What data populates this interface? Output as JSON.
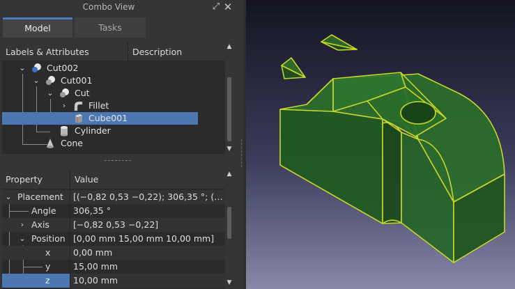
{
  "combo_view": {
    "title": "Combo View",
    "tabs": [
      {
        "label": "Model",
        "active": true
      },
      {
        "label": "Tasks",
        "active": false
      }
    ]
  },
  "tree": {
    "columns": [
      "Labels & Attributes",
      "Description"
    ],
    "items": [
      {
        "label": "Cut002",
        "icon": "cut-icon",
        "expanded": true,
        "depth": 1
      },
      {
        "label": "Cut001",
        "icon": "cut-icon",
        "expanded": true,
        "depth": 2
      },
      {
        "label": "Cut",
        "icon": "cut-icon",
        "expanded": true,
        "depth": 3
      },
      {
        "label": "Fillet",
        "icon": "fillet-icon",
        "expanded": false,
        "depth": 4
      },
      {
        "label": "Cube001",
        "icon": "cube-icon",
        "selected": true,
        "depth": 4
      },
      {
        "label": "Cylinder",
        "icon": "cylinder-icon",
        "depth": 3
      },
      {
        "label": "Cone",
        "icon": "cone-icon",
        "depth": 2
      }
    ]
  },
  "properties": {
    "columns": [
      "Property",
      "Value"
    ],
    "rows": [
      {
        "name": "Placement",
        "value": "[(−0,82 0,53 −0,22); 306,35 °; (…",
        "expanded": true
      },
      {
        "name": "Angle",
        "value": "306,35 °"
      },
      {
        "name": "Axis",
        "value": "[−0,82 0,53 −0,22]",
        "expanded": false
      },
      {
        "name": "Position",
        "value": "[0,00 mm  15,00 mm  10,00 mm]",
        "expanded": true
      },
      {
        "name": "x",
        "value": "0,00 mm"
      },
      {
        "name": "y",
        "value": "15,00 mm"
      },
      {
        "name": "z",
        "value": "10,00 mm",
        "selected": true
      }
    ]
  },
  "colors": {
    "accent": "#4d77b3",
    "model_face": "#1f5a1f",
    "model_edge": "#c8d62a"
  }
}
